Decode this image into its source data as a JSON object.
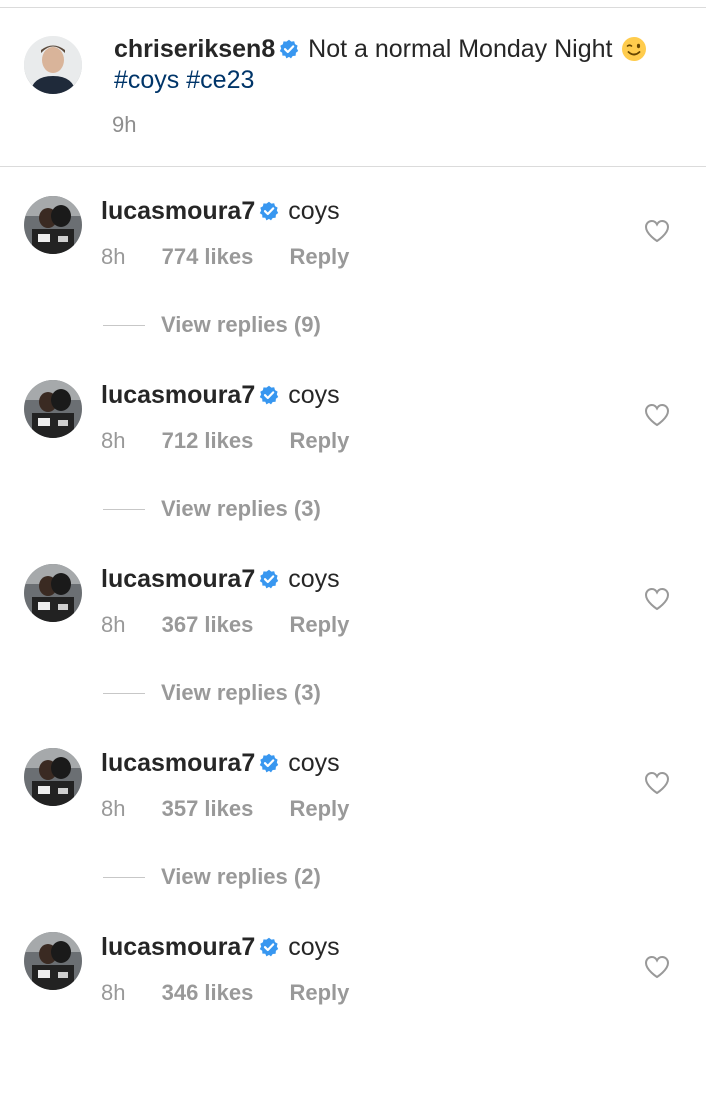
{
  "caption": {
    "username": "chriseriksen8",
    "text_before_emoji": "Not a normal Monday Night",
    "emoji": "winking-face",
    "hashtags": [
      "#coys",
      "#ce23"
    ],
    "time": "9h"
  },
  "comments": [
    {
      "username": "lucasmoura7",
      "text": "coys",
      "time": "8h",
      "likes": "774 likes",
      "reply": "Reply",
      "view_replies": "View replies (9)"
    },
    {
      "username": "lucasmoura7",
      "text": "coys",
      "time": "8h",
      "likes": "712 likes",
      "reply": "Reply",
      "view_replies": "View replies (3)"
    },
    {
      "username": "lucasmoura7",
      "text": "coys",
      "time": "8h",
      "likes": "367 likes",
      "reply": "Reply",
      "view_replies": "View replies (3)"
    },
    {
      "username": "lucasmoura7",
      "text": "coys",
      "time": "8h",
      "likes": "357 likes",
      "reply": "Reply",
      "view_replies": "View replies (2)"
    },
    {
      "username": "lucasmoura7",
      "text": "coys",
      "time": "8h",
      "likes": "346 likes",
      "reply": "Reply"
    }
  ],
  "icons": {
    "verified": "verified-badge-icon",
    "heart": "heart-outline-icon"
  },
  "colors": {
    "verified_blue": "#3897f0",
    "hashtag": "#003569",
    "muted": "#999999"
  }
}
